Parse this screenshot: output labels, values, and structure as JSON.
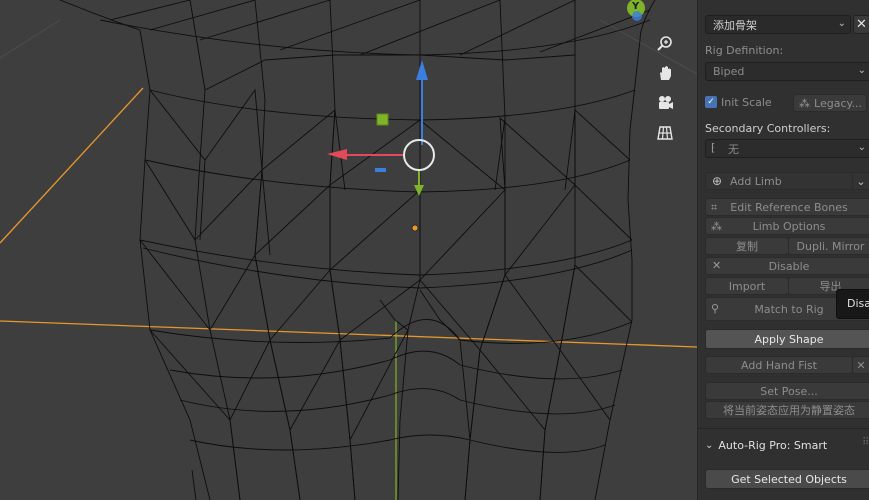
{
  "viewport": {
    "gizmo_y_label": "Y",
    "nav_icons": [
      "zoom-icon",
      "hand-icon",
      "camera-icon",
      "grid-icon"
    ]
  },
  "panel": {
    "header_dropdown": "添加骨架",
    "rig_definition_label": "Rig Definition:",
    "rig_definition_value": "Biped",
    "init_scale_label": "Init Scale",
    "init_scale_checked": true,
    "legacy_label": "Legacy...",
    "secondary_controllers_label": "Secondary Controllers:",
    "secondary_controllers_value": "无",
    "add_limb_label": "Add Limb",
    "edit_reference_bones": "Edit Reference Bones",
    "limb_options": "Limb Options",
    "copy": "复制",
    "dupli_mirror": "Dupli. Mirror",
    "disable": "Disable",
    "import": "Import",
    "export": "导出",
    "match_to_rig": "Match to Rig",
    "apply_shape": "Apply Shape",
    "add_hand_fist": "Add Hand Fist",
    "set_pose": "Set Pose...",
    "apply_pose_rest": "将当前姿态应用为静置姿态",
    "section_title": "Auto-Rig Pro: Smart",
    "get_selected_objects": "Get Selected Objects"
  },
  "tooltip": {
    "text": "Disable"
  },
  "colors": {
    "viewport_bg": "#3e3e3e",
    "panel_bg": "#303030",
    "axis_x": "#e24a5a",
    "axis_y": "#7fb32a",
    "axis_z": "#3b7ee0",
    "highlight_edge": "#e8972c"
  }
}
